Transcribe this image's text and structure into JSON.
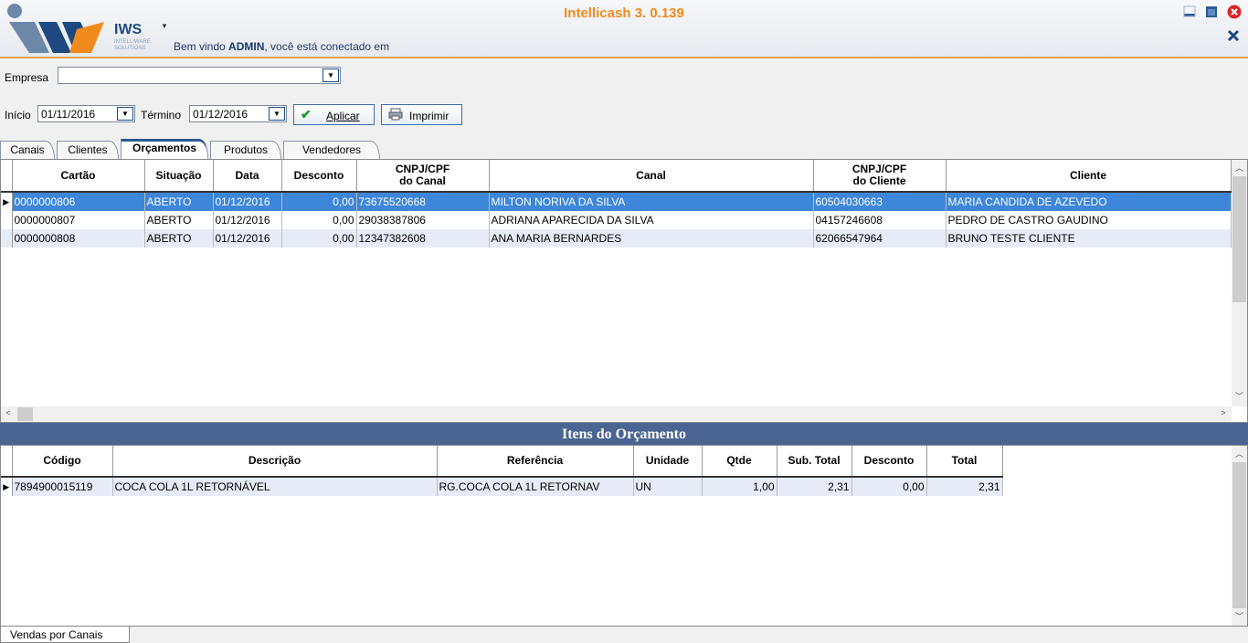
{
  "app": {
    "title": "Intellicash 3. 0.139",
    "welcome_prefix": "Bem vindo ",
    "welcome_user": "ADMIN",
    "welcome_suffix": ", você está conectado em",
    "logo_text": "IWS",
    "logo_sub": "INTELLIWARE SOLUTIONS",
    "accent": "#f08a1c",
    "brand": "#1e4880"
  },
  "form": {
    "empresa_label": "Empresa",
    "empresa_value": "",
    "inicio_label": "Início",
    "inicio_value": "01/11/2016",
    "termino_label": "Término",
    "termino_value": "01/12/2016",
    "aplicar_label": "Aplicar",
    "imprimir_label": "Imprimir"
  },
  "tabs": [
    "Canais",
    "Clientes",
    "Orçamentos",
    "Produtos",
    "Vendedores"
  ],
  "active_tab": "Orçamentos",
  "orcamentos": {
    "columns": [
      "Cartão",
      "Situação",
      "Data",
      "Desconto",
      "CNPJ/CPF do Canal",
      "Canal",
      "CNPJ/CPF do Cliente",
      "Cliente"
    ],
    "rows": [
      [
        "0000000806",
        "ABERTO",
        "01/12/2016",
        "0,00",
        "73675520668",
        "MILTON NORIVA DA SILVA",
        "60504030663",
        "MARIA CANDIDA DE AZEVEDO"
      ],
      [
        "0000000807",
        "ABERTO",
        "01/12/2016",
        "0,00",
        "29038387806",
        "ADRIANA APARECIDA DA SILVA",
        "04157246608",
        "PEDRO DE CASTRO GAUDINO"
      ],
      [
        "0000000808",
        "ABERTO",
        "01/12/2016",
        "0,00",
        "12347382608",
        "ANA MARIA BERNARDES",
        "62066547964",
        "BRUNO TESTE CLIENTE"
      ]
    ],
    "selected_row": 0
  },
  "itens": {
    "title": "Itens do Orçamento",
    "columns": [
      "Código",
      "Descrição",
      "Referência",
      "Unidade",
      "Qtde",
      "Sub. Total",
      "Desconto",
      "Total"
    ],
    "rows": [
      [
        "7894900015119",
        "COCA COLA 1L RETORNÁVEL",
        "RG.COCA COLA 1L RETORNAV",
        "UN",
        "1,00",
        "2,31",
        "0,00",
        "2,31"
      ]
    ]
  },
  "footer": {
    "tab_label": "Vendas por Canais"
  },
  "icons": {
    "minimize": "minimize-icon",
    "maximize": "maximize-icon",
    "close": "close-icon",
    "aplicar": "check-icon",
    "imprimir": "printer-icon"
  }
}
